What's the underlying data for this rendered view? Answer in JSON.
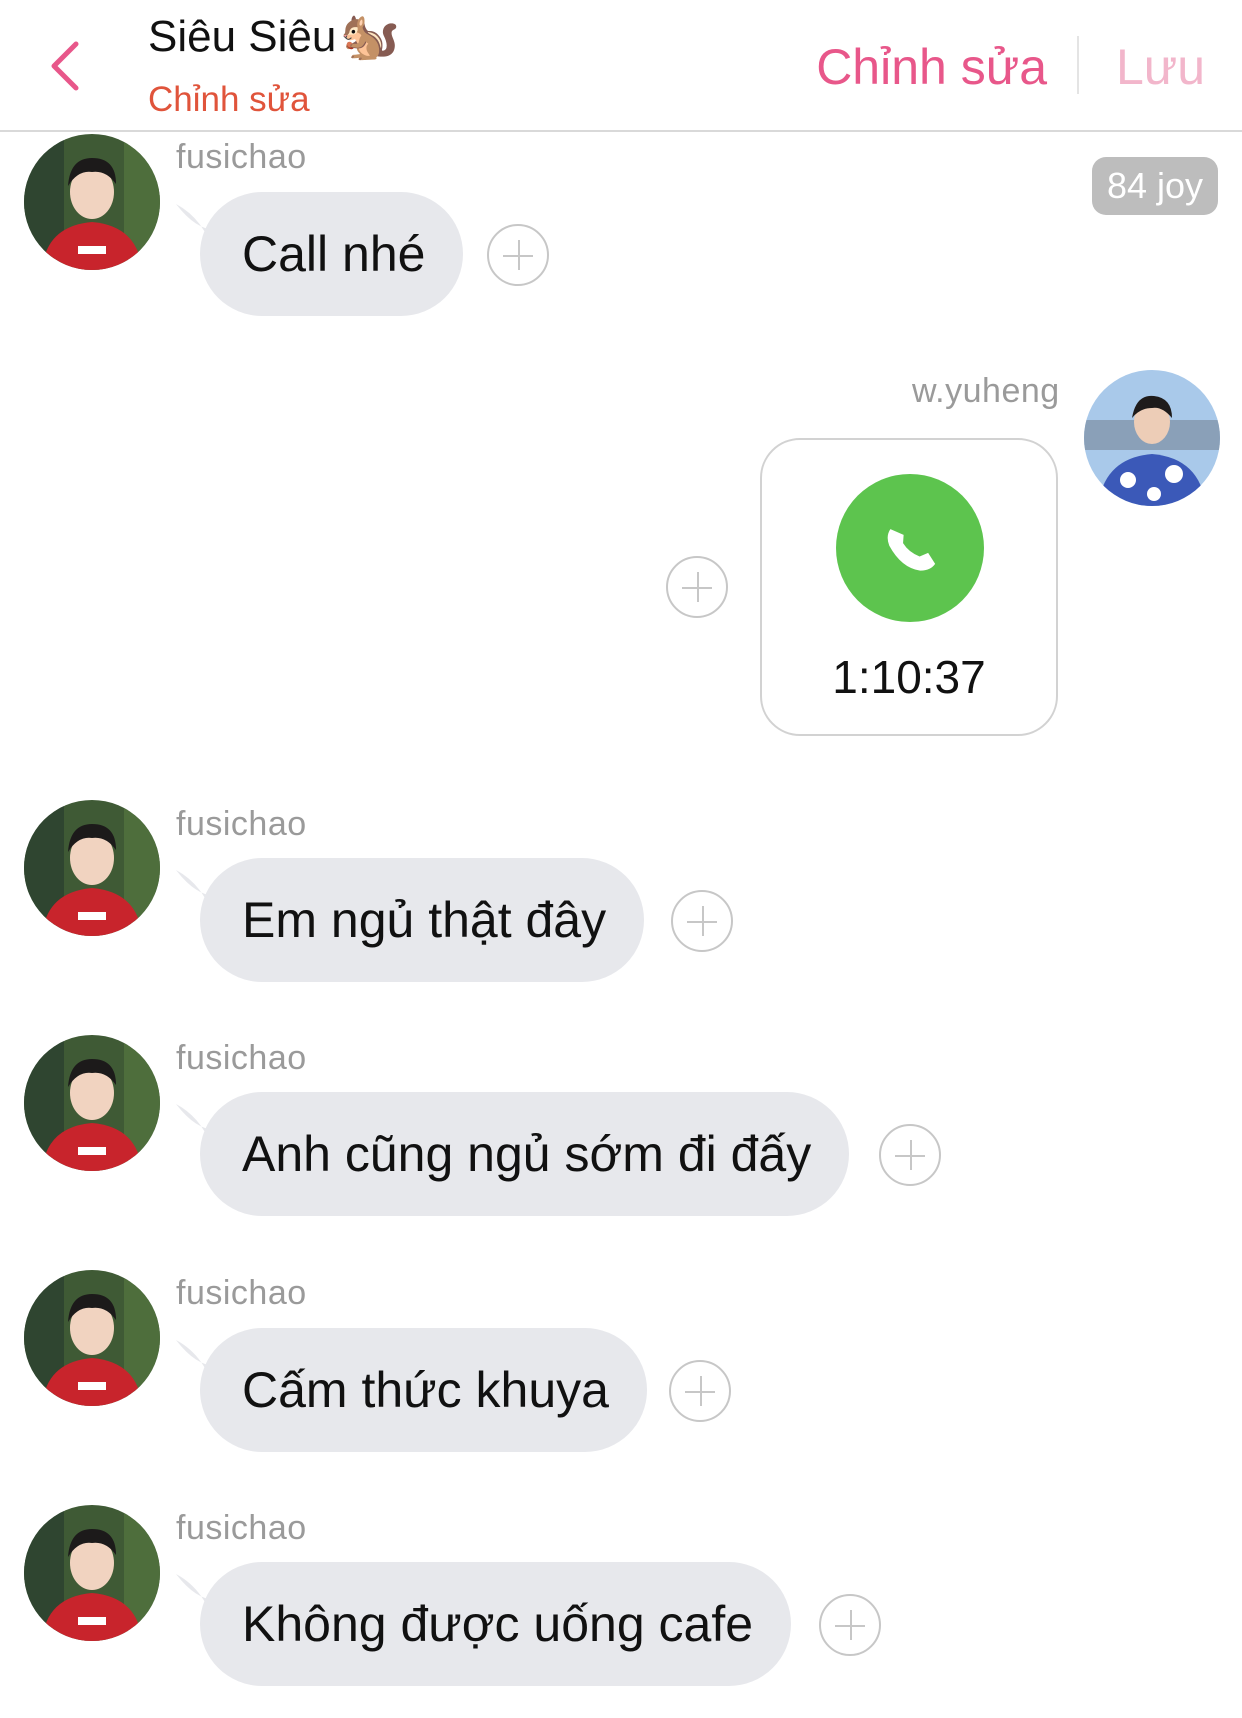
{
  "header": {
    "title": "Siêu Siêu",
    "title_emoji": "🐿️",
    "subtitle": "Chỉnh sửa",
    "edit_label": "Chỉnh sửa",
    "save_label": "Lưu"
  },
  "badge": "84 joy",
  "messages": [
    {
      "sender": "fusichao",
      "text": "Call nhé"
    },
    {
      "sender": "w.yuheng",
      "call_duration": "1:10:37"
    },
    {
      "sender": "fusichao",
      "text": "Em ngủ thật đây"
    },
    {
      "sender": "fusichao",
      "text": "Anh cũng ngủ sớm đi đấy"
    },
    {
      "sender": "fusichao",
      "text": "Cấm thức khuya"
    },
    {
      "sender": "fusichao",
      "text": "Không được uống cafe"
    }
  ],
  "colors": {
    "accent_pink": "#e8578a",
    "subtitle_red": "#e0543b",
    "bubble_gray": "#e7e8ec",
    "call_green": "#5dc44e"
  }
}
